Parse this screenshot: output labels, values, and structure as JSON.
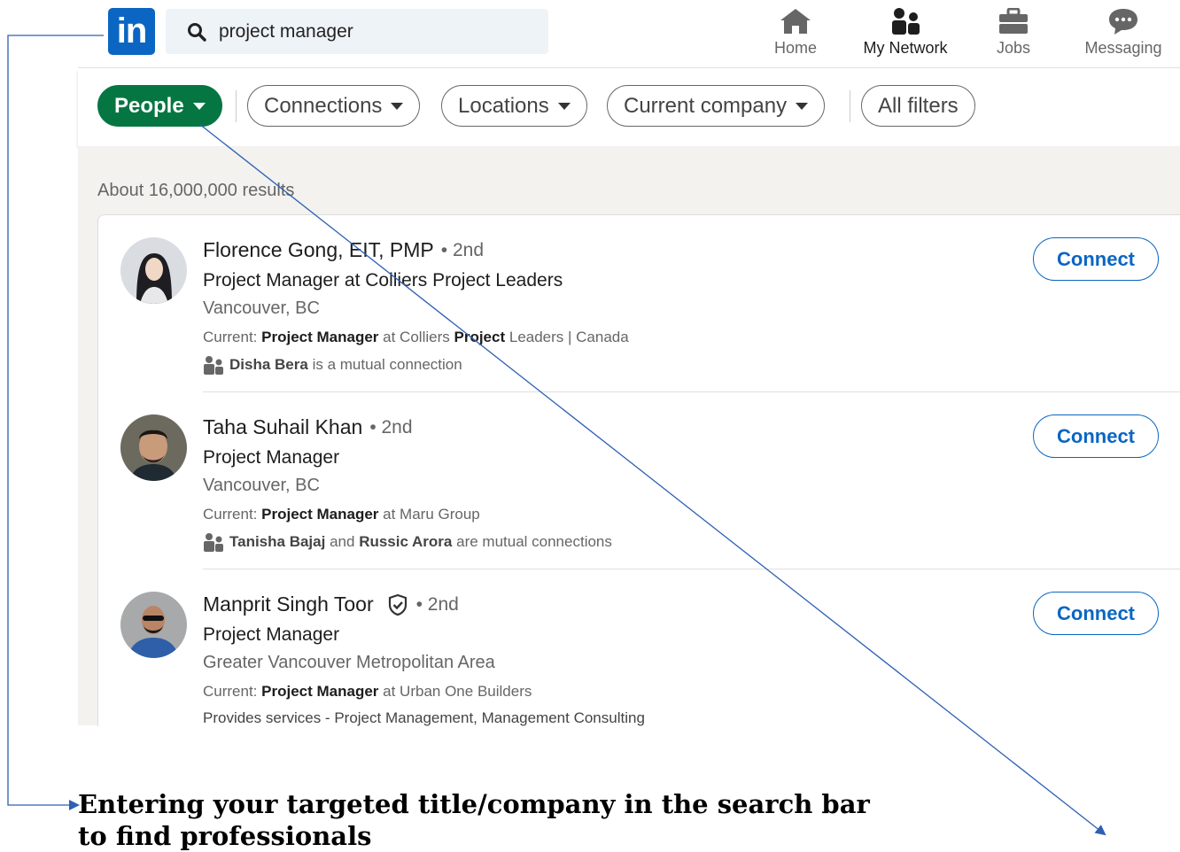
{
  "header": {
    "search_value": "project manager",
    "nav": [
      {
        "label": "Home",
        "icon": "home-icon"
      },
      {
        "label": "My Network",
        "icon": "network-icon"
      },
      {
        "label": "Jobs",
        "icon": "briefcase-icon"
      },
      {
        "label": "Messaging",
        "icon": "message-icon"
      }
    ],
    "logo_text": "in"
  },
  "filters": [
    {
      "label": "People"
    },
    {
      "label": "Connections"
    },
    {
      "label": "Locations"
    },
    {
      "label": "Current company"
    },
    {
      "label": "All filters"
    }
  ],
  "results_count": "About 16,000,000 results",
  "results": [
    {
      "name": "Florence Gong, EIT, PMP",
      "degree": "• 2nd",
      "headline": "Project Manager at Colliers Project Leaders",
      "location": "Vancouver, BC",
      "current_prefix": "Current:",
      "current_bold1": "Project Manager",
      "current_mid": "at Colliers",
      "current_bold2": "Project",
      "current_tail": "Leaders | Canada",
      "mutual_a": "Disha Bera",
      "mutual_text": "is a mutual connection",
      "connect_label": "Connect"
    },
    {
      "name": "Taha Suhail Khan",
      "degree": "• 2nd",
      "headline": "Project Manager",
      "location": "Vancouver, BC",
      "current_prefix": "Current:",
      "current_bold1": "Project Manager",
      "current_mid": "at Maru Group",
      "mutual_a": "Tanisha Bajaj",
      "mutual_and": "and",
      "mutual_b": "Russic Arora",
      "mutual_text": "are mutual connections",
      "connect_label": "Connect"
    },
    {
      "name": "Manprit Singh Toor",
      "degree": "• 2nd",
      "headline": "Project Manager",
      "location": "Greater Vancouver Metropolitan Area",
      "current_prefix": "Current:",
      "current_bold1": "Project Manager",
      "current_mid": "at Urban One Builders",
      "services": "Provides services - Project Management, Management Consulting",
      "connect_label": "Connect"
    }
  ],
  "caption_line1": "Entering your targeted title/company in the search bar",
  "caption_line2": "to find professionals",
  "colors": {
    "brand": "#0a66c2",
    "people_pill": "#057642",
    "annotation": "#2e5fb5"
  }
}
